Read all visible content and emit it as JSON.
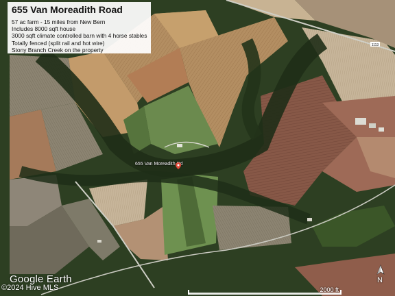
{
  "listing": {
    "title": "655 Van Moreadith Road",
    "lines": [
      "57 ac farm - 15 miles from New Bern",
      "Includes 8000 sqft house",
      "3000 sqft climate controlled barn with 4 horse stables",
      "Totally fenced (split rail and hot wire)",
      "Stony Branch Creek on the property"
    ]
  },
  "map": {
    "place_label": "655 Van Moreadith Rd",
    "road_sign": "1113",
    "attribution_logo": "Google Earth",
    "copyright": "©2024 Hive MLS",
    "scale_label": "2000 ft",
    "north_label": "N",
    "icons": [
      "map-pin-icon",
      "north-arrow-icon"
    ],
    "colors": {
      "forest": "#2c3d20",
      "field_tan": "#b99867",
      "field_brown": "#8a5a47",
      "field_green": "#6f8a52",
      "road": "#cfcfc6"
    }
  }
}
